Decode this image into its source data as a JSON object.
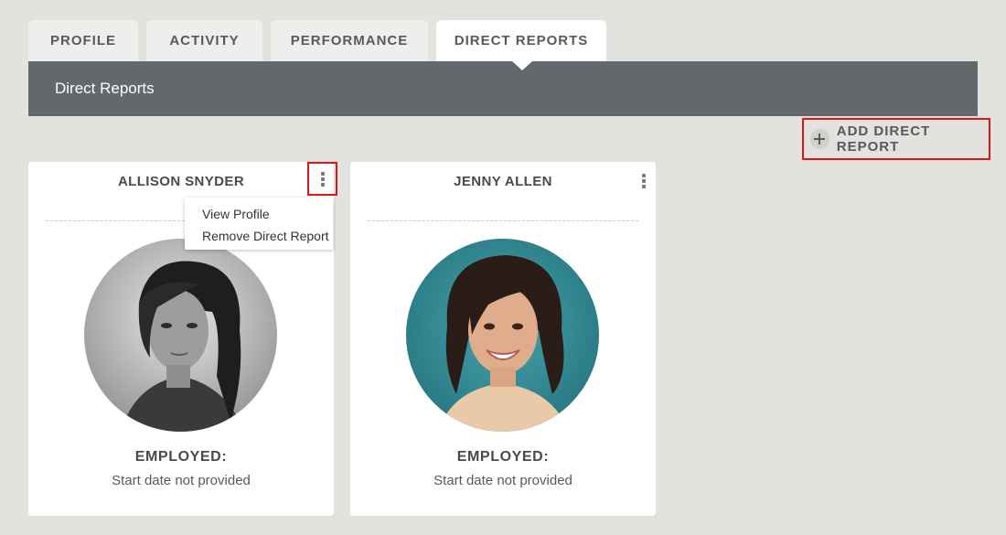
{
  "tabs": [
    {
      "label": "PROFILE",
      "active": false
    },
    {
      "label": "ACTIVITY",
      "active": false
    },
    {
      "label": "PERFORMANCE",
      "active": false
    },
    {
      "label": "DIRECT REPORTS",
      "active": true
    }
  ],
  "section": {
    "title": "Direct Reports"
  },
  "add_button": {
    "label": "ADD DIRECT REPORT",
    "icon": "plus-icon"
  },
  "cards": [
    {
      "name": "ALLISON SNYDER",
      "status_label": "EMPLOYED:",
      "status_text": "Start date not provided",
      "photo": "grayscale portrait"
    },
    {
      "name": "JENNY ALLEN",
      "status_label": "EMPLOYED:",
      "status_text": "Start date not provided",
      "photo": "color portrait"
    }
  ],
  "menu": {
    "items": [
      "View Profile",
      "Remove Direct Report"
    ]
  },
  "colors": {
    "background": "#e2e2de",
    "header_bar": "#63686c",
    "highlight": "#e0141b",
    "tab_text": "#555a5e"
  }
}
